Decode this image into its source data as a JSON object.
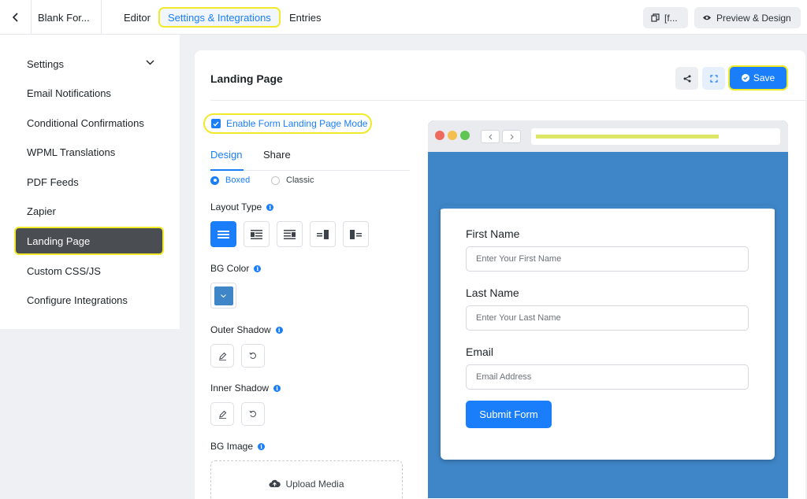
{
  "header": {
    "form_title": "Blank For...",
    "tabs": [
      {
        "label": "Editor"
      },
      {
        "label": "Settings & Integrations"
      },
      {
        "label": "Entries"
      }
    ],
    "shortcode_label": "[f...",
    "preview_label": "Preview & Design"
  },
  "sidebar": {
    "items": [
      {
        "label": "Settings"
      },
      {
        "label": "Email Notifications"
      },
      {
        "label": "Conditional Confirmations"
      },
      {
        "label": "WPML Translations"
      },
      {
        "label": "PDF Feeds"
      },
      {
        "label": "Zapier"
      },
      {
        "label": "Landing Page"
      },
      {
        "label": "Custom CSS/JS"
      },
      {
        "label": "Configure Integrations"
      }
    ],
    "active": "Landing Page"
  },
  "main": {
    "title": "Landing Page",
    "save_label": "Save",
    "enable_label": "Enable Form Landing Page Mode",
    "enable_checked": true,
    "tabs": [
      {
        "label": "Design"
      },
      {
        "label": "Share"
      }
    ],
    "active_tab": "Design",
    "style_options": [
      {
        "label": "Boxed",
        "selected": true
      },
      {
        "label": "Classic",
        "selected": false
      }
    ],
    "layout_type_label": "Layout Type",
    "bg_color_label": "BG Color",
    "bg_color_value": "#3f86c8",
    "outer_shadow_label": "Outer Shadow",
    "inner_shadow_label": "Inner Shadow",
    "bg_image_label": "BG Image",
    "upload_label": "Upload Media"
  },
  "preview": {
    "fields": [
      {
        "label": "First Name",
        "placeholder": "Enter Your First Name"
      },
      {
        "label": "Last Name",
        "placeholder": "Enter Your Last Name"
      },
      {
        "label": "Email",
        "placeholder": "Email Address"
      }
    ],
    "submit_label": "Submit Form"
  },
  "colors": {
    "accent": "#1a7efb",
    "highlight": "#f1ea28",
    "preview_bg": "#3f86c8",
    "sidebar_active": "#4a4d51"
  }
}
